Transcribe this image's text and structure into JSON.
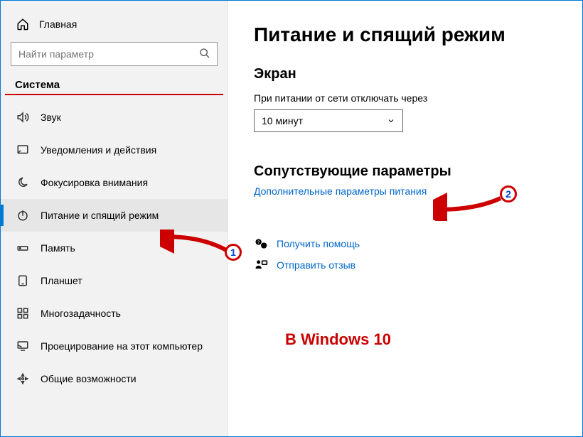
{
  "home_label": "Главная",
  "search_placeholder": "Найти параметр",
  "section_header": "Система",
  "nav": [
    {
      "label": "Звук",
      "icon": "sound"
    },
    {
      "label": "Уведомления и действия",
      "icon": "notifications"
    },
    {
      "label": "Фокусировка внимания",
      "icon": "focus"
    },
    {
      "label": "Питание и спящий режим",
      "icon": "power",
      "active": true
    },
    {
      "label": "Память",
      "icon": "storage"
    },
    {
      "label": "Планшет",
      "icon": "tablet"
    },
    {
      "label": "Многозадачность",
      "icon": "multitask"
    },
    {
      "label": "Проецирование на этот компьютер",
      "icon": "projecting"
    },
    {
      "label": "Общие возможности",
      "icon": "shared"
    }
  ],
  "main": {
    "title": "Питание и спящий режим",
    "screen_heading": "Экран",
    "screen_field_label": "При питании от сети отключать через",
    "screen_select_value": "10 минут",
    "related_heading": "Сопутствующие параметры",
    "related_link": "Дополнительные параметры питания",
    "help_label": "Получить помощь",
    "feedback_label": "Отправить отзыв"
  },
  "annotation": {
    "badge1": "1",
    "badge2": "2",
    "text": "В Windows 10"
  }
}
